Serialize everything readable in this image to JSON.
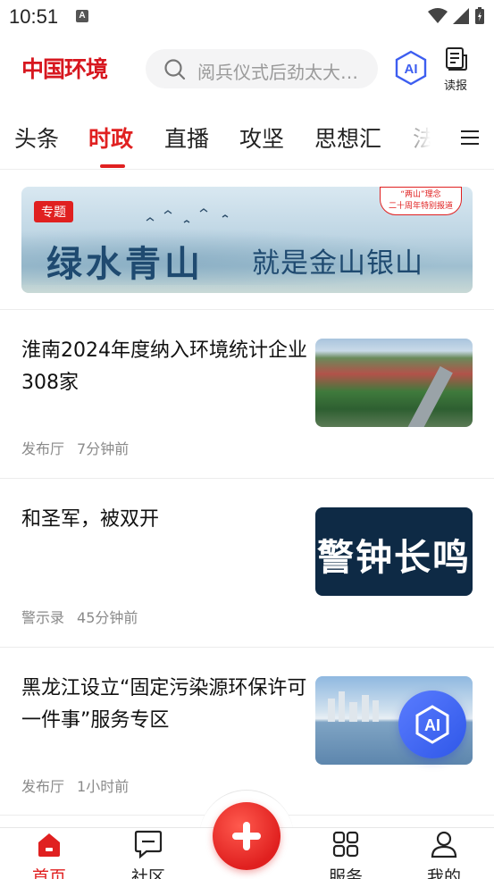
{
  "status_bar": {
    "time": "10:51",
    "a_icon": "A"
  },
  "header": {
    "logo": "中国环境",
    "search_placeholder": "阅兵仪式后劲太大…",
    "ai_button_label": "AI",
    "read_label": "读报"
  },
  "tabs": [
    {
      "label": "头条"
    },
    {
      "label": "时政"
    },
    {
      "label": "直播"
    },
    {
      "label": "攻坚"
    },
    {
      "label": "思想汇"
    },
    {
      "label": "法"
    }
  ],
  "banner": {
    "tag": "专题",
    "title_main": "绿水青山",
    "title_sub": "就是金山银山",
    "badge_line1": "“两山”理念",
    "badge_line2": "二十周年特别报道"
  },
  "news": [
    {
      "headline": "淮南2024年度纳入环境统计企业308家",
      "source": "发布厅",
      "time": "7分钟前"
    },
    {
      "headline": "和圣军，被双开",
      "source": "警示录",
      "time": "45分钟前",
      "thumb_text": "警钟长鸣"
    },
    {
      "headline": "黑龙江设立“固定污染源环保许可一件事”服务专区",
      "source": "发布厅",
      "time": "1小时前"
    }
  ],
  "floating_ai": {
    "label": "AI"
  },
  "bottom_nav": [
    {
      "label": "首页",
      "icon": "home-icon",
      "active": true
    },
    {
      "label": "社区",
      "icon": "chat-icon"
    },
    {
      "label": "服务",
      "icon": "grid-icon"
    },
    {
      "label": "我的",
      "icon": "user-icon"
    }
  ],
  "colors": {
    "accent": "#e02020",
    "ai_blue": "#3d5ef0"
  }
}
